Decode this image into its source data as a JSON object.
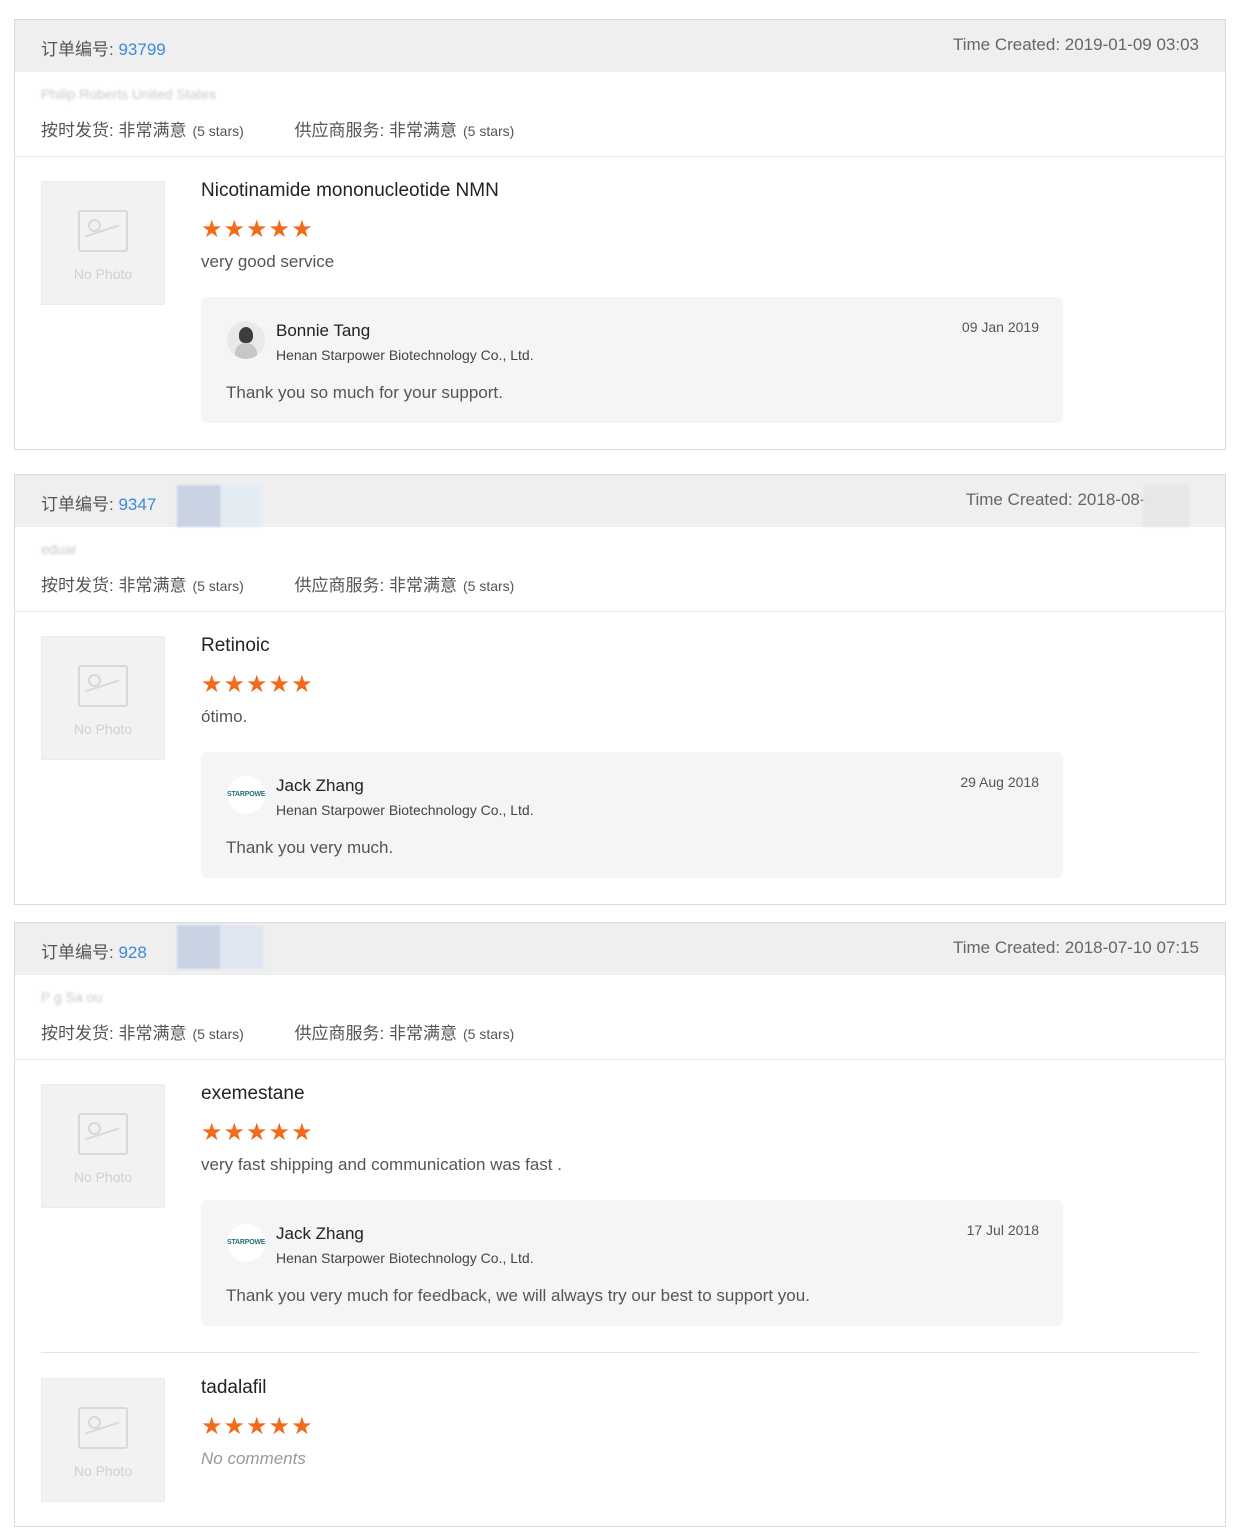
{
  "orders": [
    {
      "order_label": "订单编号: ",
      "order_number": "93799",
      "time_created": "Time Created: 2019-01-09 03:03",
      "buyer": "Philip Roberts United States",
      "ratings": {
        "shipping_label": "按时发货: 非常满意",
        "shipping_stars": "(5 stars)",
        "service_label": "供应商服务: 非常满意",
        "service_stars": "(5 stars)"
      },
      "items": [
        {
          "product": "Nicotinamide mononucleotide NMN",
          "stars": "★★★★★",
          "comment": "very good service",
          "no_photo": "No Photo",
          "reply": {
            "name": "Bonnie Tang",
            "company": "Henan Starpower Biotechnology Co., Ltd.",
            "date": "09 Jan 2019",
            "text": "Thank you so much for your support.",
            "avatar": "person-avatar"
          }
        }
      ]
    },
    {
      "order_label": "订单编号: ",
      "order_number": "9347",
      "time_created": "Time Created: 2018-08-2",
      "buyer": "eduar",
      "ratings": {
        "shipping_label": "按时发货: 非常满意",
        "shipping_stars": "(5 stars)",
        "service_label": "供应商服务: 非常满意",
        "service_stars": "(5 stars)"
      },
      "items": [
        {
          "product": "Retinoic",
          "stars": "★★★★★",
          "comment": "ótimo.",
          "no_photo": "No Photo",
          "reply": {
            "name": "Jack Zhang",
            "company": "Henan Starpower Biotechnology Co., Ltd.",
            "date": "29 Aug 2018",
            "text": "Thank you very much.",
            "avatar": "STARPOWER"
          }
        }
      ]
    },
    {
      "order_label": "订单编号: ",
      "order_number": "928",
      "time_created": "Time Created: 2018-07-10 07:15",
      "buyer": "P g Sa ou",
      "ratings": {
        "shipping_label": "按时发货: 非常满意",
        "shipping_stars": "(5 stars)",
        "service_label": "供应商服务: 非常满意",
        "service_stars": "(5 stars)"
      },
      "items": [
        {
          "product": "exemestane",
          "stars": "★★★★★",
          "comment": "very fast shipping and communication was fast .",
          "no_photo": "No Photo",
          "reply": {
            "name": "Jack Zhang",
            "company": "Henan Starpower Biotechnology Co., Ltd.",
            "date": "17 Jul 2018",
            "text": "Thank you very much for feedback, we will always try our best to support you.",
            "avatar": "STARPOWER"
          }
        },
        {
          "product": "tadalafil",
          "stars": "★★★★★",
          "comment": "No comments",
          "no_photo": "No Photo"
        }
      ]
    }
  ],
  "colors": {
    "star": "#f26a1b",
    "order_number": "#3b8bd8",
    "header_bg": "#efefef",
    "reply_bg": "#f4f5f7"
  }
}
